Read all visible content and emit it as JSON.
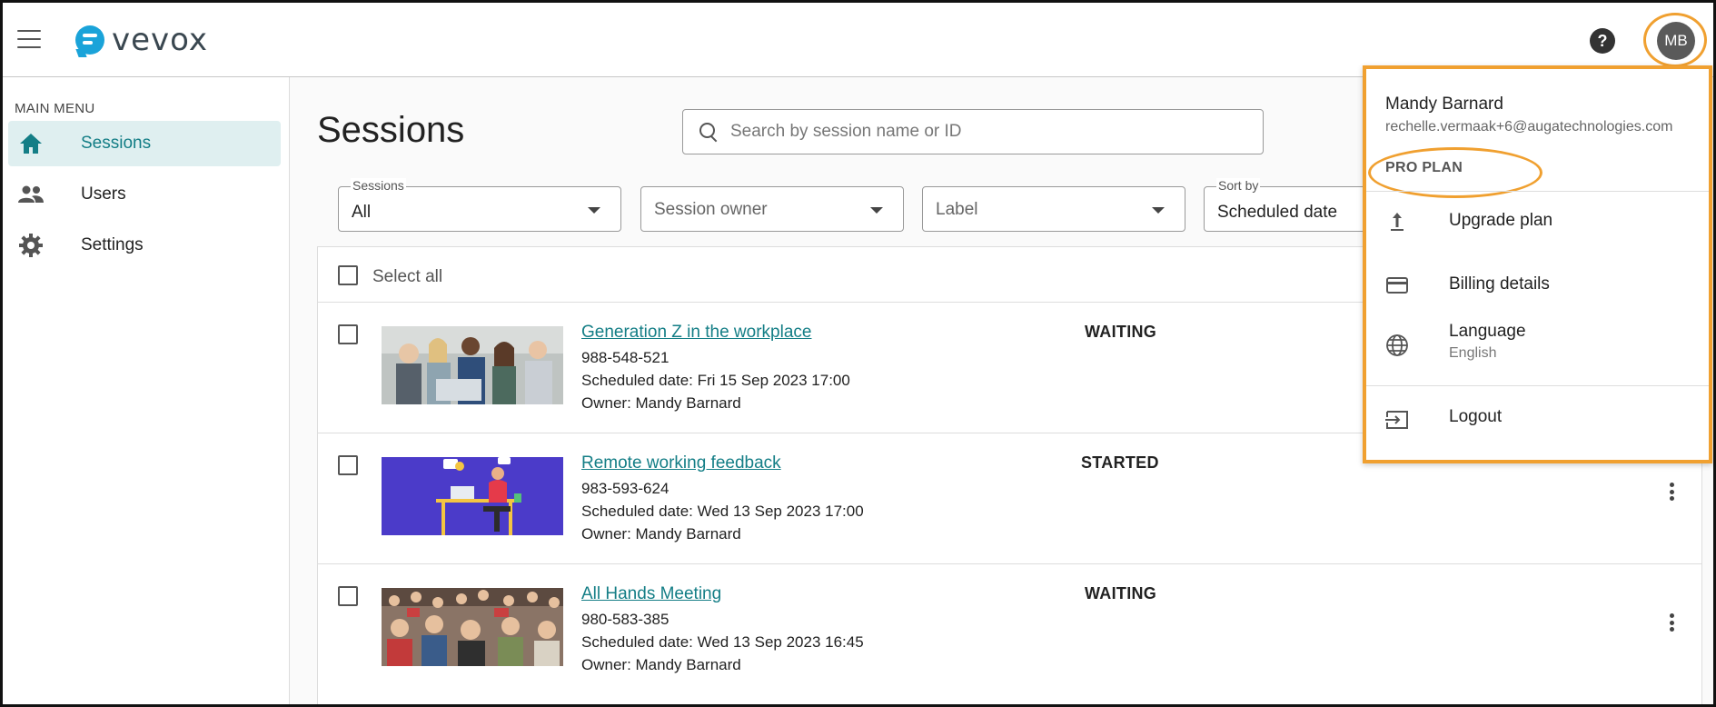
{
  "app": {
    "logo_text": "vevox"
  },
  "header": {
    "help_label": "?",
    "avatar_initials": "MB"
  },
  "sidebar": {
    "heading": "MAIN MENU",
    "items": [
      {
        "label": "Sessions",
        "icon": "home-icon",
        "active": true
      },
      {
        "label": "Users",
        "icon": "people-icon",
        "active": false
      },
      {
        "label": "Settings",
        "icon": "gear-icon",
        "active": false
      }
    ]
  },
  "main": {
    "title": "Sessions",
    "search": {
      "placeholder": "Search by session name or ID",
      "value": ""
    },
    "filters": {
      "sessions": {
        "label": "Sessions",
        "value": "All"
      },
      "owner": {
        "placeholder": "Session owner"
      },
      "label": {
        "placeholder": "Label"
      },
      "sort": {
        "label": "Sort by",
        "value": "Scheduled date"
      }
    },
    "select_all_label": "Select all",
    "sessions": [
      {
        "title": "Generation Z in the workplace",
        "id": "988-548-521",
        "scheduled": "Scheduled date: Fri 15 Sep 2023 17:00",
        "owner": "Owner: Mandy Barnard",
        "status": "WAITING"
      },
      {
        "title": "Remote working feedback",
        "id": "983-593-624",
        "scheduled": "Scheduled date: Wed 13 Sep 2023 17:00",
        "owner": "Owner: Mandy Barnard",
        "status": "STARTED"
      },
      {
        "title": "All Hands Meeting",
        "id": "980-583-385",
        "scheduled": "Scheduled date: Wed 13 Sep 2023 16:45",
        "owner": "Owner: Mandy Barnard",
        "status": "WAITING"
      }
    ]
  },
  "account_menu": {
    "name": "Mandy Barnard",
    "email": "rechelle.vermaak+6@augatechnologies.com",
    "plan": "PRO PLAN",
    "items": [
      {
        "label": "Upgrade plan",
        "icon": "upload-icon"
      },
      {
        "label": "Billing details",
        "icon": "credit-card-icon"
      },
      {
        "label": "Language",
        "sublabel": "English",
        "icon": "globe-icon"
      },
      {
        "label": "Logout",
        "icon": "logout-icon"
      }
    ]
  },
  "colors": {
    "accent": "#147e86",
    "highlight": "#f0a030",
    "logo": "#1aa3d9",
    "active_bg": "#dfeff0"
  }
}
